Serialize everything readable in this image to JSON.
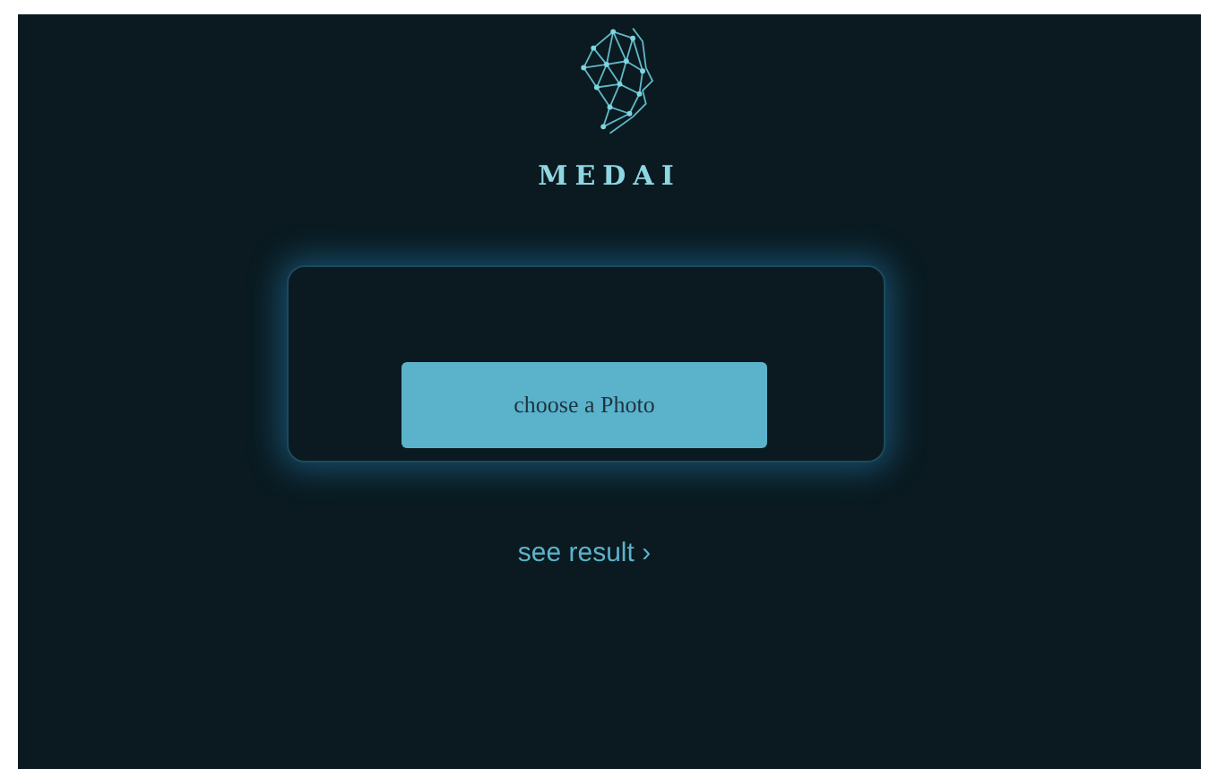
{
  "logo": {
    "text": "MEDAI"
  },
  "upload": {
    "button": "choose a Photo"
  },
  "result_link": "see result ›"
}
